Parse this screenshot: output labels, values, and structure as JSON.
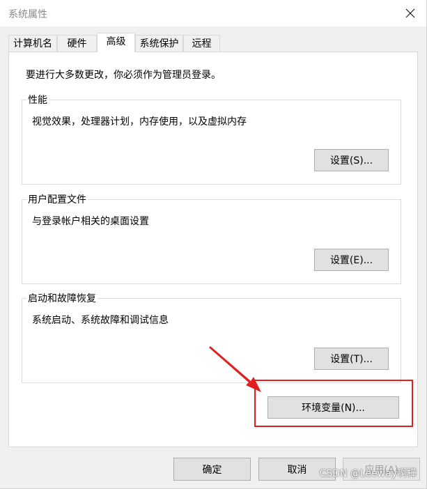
{
  "window": {
    "title": "系统属性"
  },
  "tabs": [
    {
      "label": "计算机名",
      "active": false
    },
    {
      "label": "硬件",
      "active": false
    },
    {
      "label": "高级",
      "active": true
    },
    {
      "label": "系统保护",
      "active": false
    },
    {
      "label": "远程",
      "active": false
    }
  ],
  "advanced": {
    "notice": "要进行大多数更改，你必须作为管理员登录。",
    "performance": {
      "label": "性能",
      "description": "视觉效果，处理器计划，内存使用，以及虚拟内存",
      "button": "设置(S)..."
    },
    "user_profiles": {
      "label": "用户配置文件",
      "description": "与登录帐户相关的桌面设置",
      "button": "设置(E)..."
    },
    "startup_recovery": {
      "label": "启动和故障恢复",
      "description": "系统启动、系统故障和调试信息",
      "button": "设置(T)..."
    },
    "env_button": "环境变量(N)..."
  },
  "footer": {
    "ok": "确定",
    "cancel": "取消",
    "apply": "应用(A)"
  },
  "annotation": {
    "color": "#e02020"
  },
  "watermark": "CSDN @Leeway啊樺",
  "icons": {
    "close": "close-icon"
  }
}
